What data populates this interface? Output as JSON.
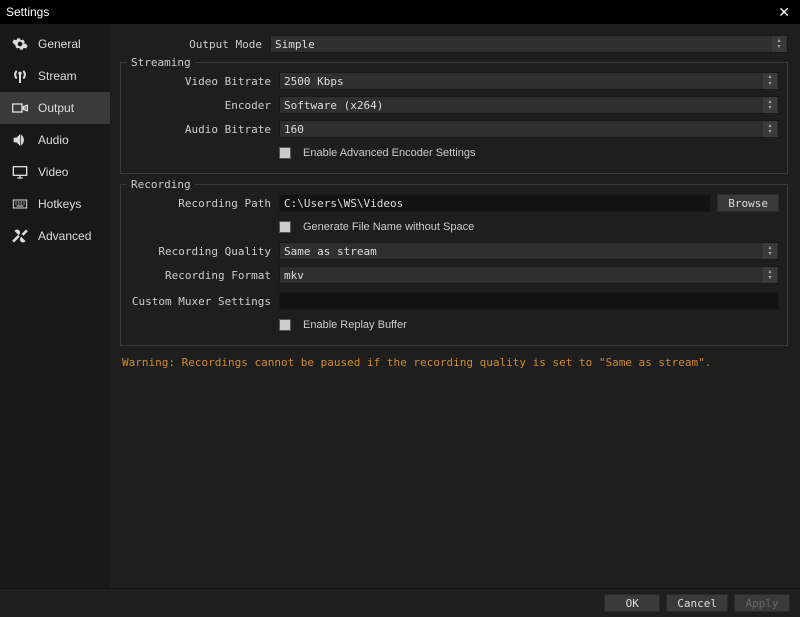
{
  "window": {
    "title": "Settings"
  },
  "sidebar": {
    "items": [
      {
        "label": "General"
      },
      {
        "label": "Stream"
      },
      {
        "label": "Output"
      },
      {
        "label": "Audio"
      },
      {
        "label": "Video"
      },
      {
        "label": "Hotkeys"
      },
      {
        "label": "Advanced"
      }
    ],
    "active_index": 2
  },
  "output_mode": {
    "label": "Output Mode",
    "value": "Simple"
  },
  "streaming": {
    "title": "Streaming",
    "video_bitrate": {
      "label": "Video Bitrate",
      "value": "2500 Kbps"
    },
    "encoder": {
      "label": "Encoder",
      "value": "Software (x264)"
    },
    "audio_bitrate": {
      "label": "Audio Bitrate",
      "value": "160"
    },
    "advanced_checkbox": {
      "label": "Enable Advanced Encoder Settings",
      "checked": false
    }
  },
  "recording": {
    "title": "Recording",
    "path": {
      "label": "Recording Path",
      "value": "C:\\Users\\WS\\Videos",
      "browse": "Browse"
    },
    "no_space_checkbox": {
      "label": "Generate File Name without Space",
      "checked": false
    },
    "quality": {
      "label": "Recording Quality",
      "value": "Same as stream"
    },
    "format": {
      "label": "Recording Format",
      "value": "mkv"
    },
    "muxer": {
      "label": "Custom Muxer Settings",
      "value": ""
    },
    "replay_checkbox": {
      "label": "Enable Replay Buffer",
      "checked": false
    }
  },
  "warning": "Warning: Recordings cannot be paused if the recording quality is set to \"Same as stream\".",
  "footer": {
    "ok": "OK",
    "cancel": "Cancel",
    "apply": "Apply"
  }
}
